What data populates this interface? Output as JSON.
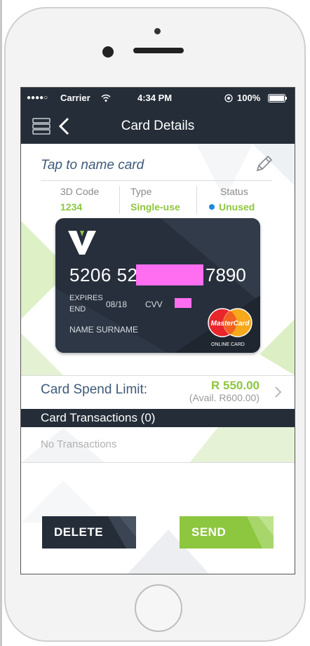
{
  "status_bar": {
    "signal": "●●●●○",
    "carrier": "Carrier",
    "time": "4:34 PM",
    "battery": "100%"
  },
  "header": {
    "title": "Card Details"
  },
  "card_name": {
    "placeholder": "Tap to name card"
  },
  "info": {
    "code_label": "3D Code",
    "code_value": "1234",
    "type_label": "Type",
    "type_value": "Single-use",
    "status_label": "Status",
    "status_value": "Unused"
  },
  "card": {
    "number_start": "5206 52",
    "number_end": "7890",
    "expires_label": "EXPIRES END",
    "expiry": "08/18",
    "cvv_label": "CVV",
    "holder": "NAME SURNAME",
    "network_label": "MasterCard",
    "network_caption": "ONLINE CARD"
  },
  "spend": {
    "label": "Card Spend Limit:",
    "amount": "R 550.00",
    "available": "(Avail. R600.00)"
  },
  "transactions": {
    "header": "Card Transactions (0)",
    "empty": "No Transactions"
  },
  "actions": {
    "delete_label": "DELETE",
    "send_label": "SEND"
  },
  "colors": {
    "nav": "#252d38",
    "accent": "#8dc63f",
    "link": "#3e5a7a",
    "redaction": "#ff6ef0"
  },
  "icons": [
    "menu-icon",
    "back-icon",
    "wifi-icon",
    "lock-rotation-icon",
    "battery-icon",
    "pencil-icon",
    "chevron-right-icon"
  ]
}
